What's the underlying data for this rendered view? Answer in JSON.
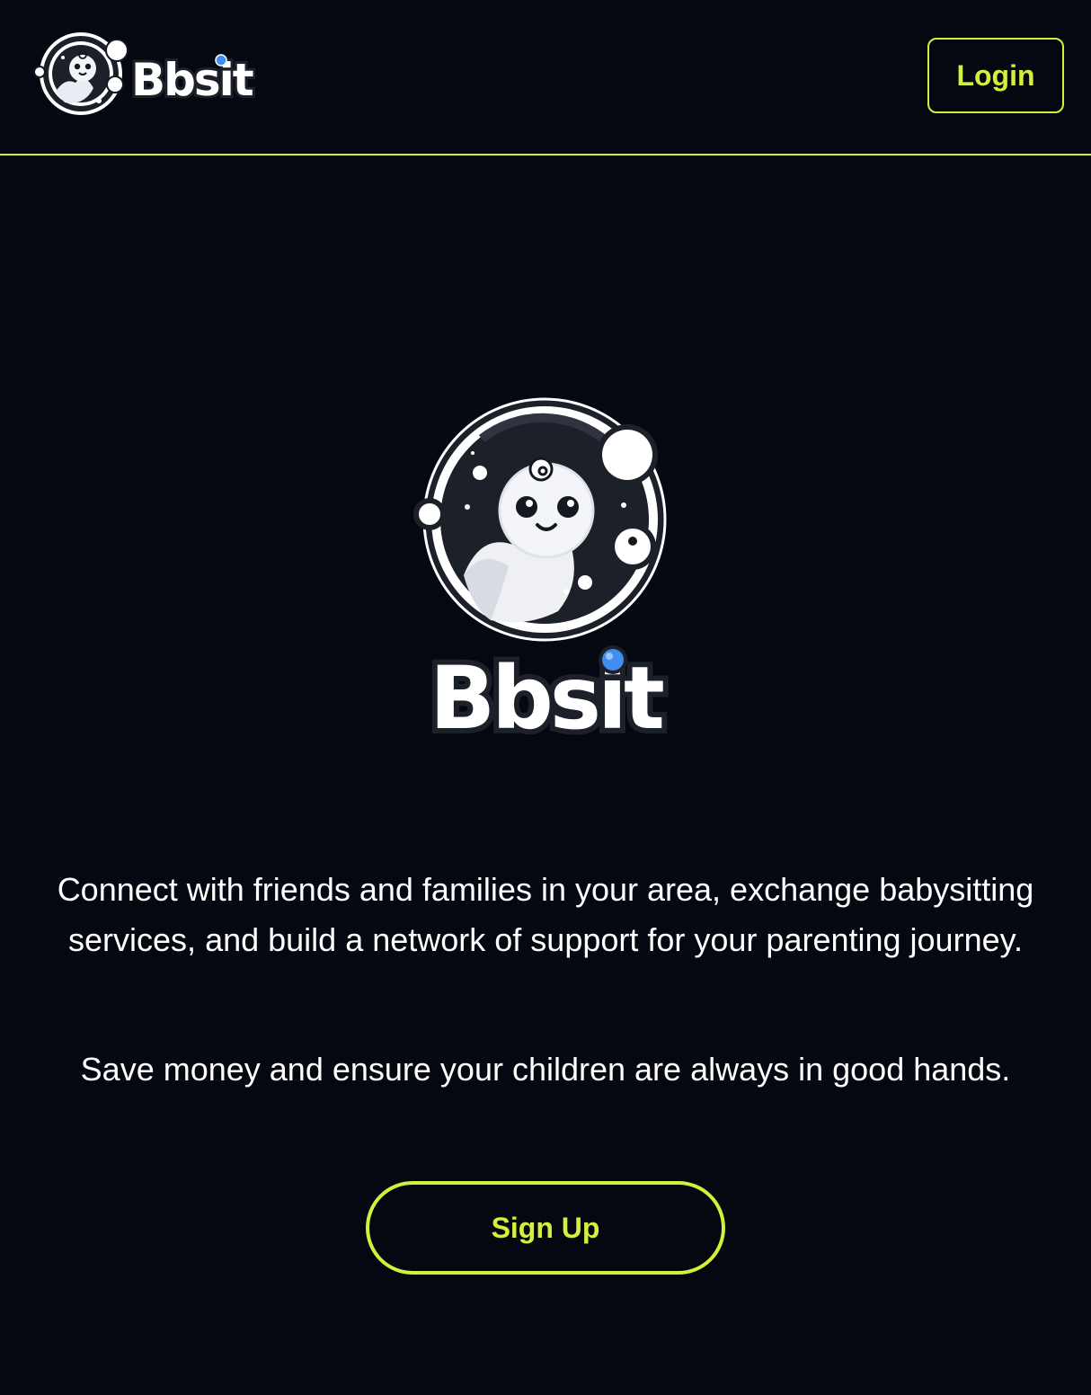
{
  "header": {
    "brand_name": "Bbsit",
    "login_label": "Login"
  },
  "hero": {
    "brand_name": "Bbsit",
    "tagline": "Connect with friends and families in your area, exchange babysitting services, and build a network of support for your parenting journey.",
    "subtagline": "Save money and ensure your children are always in good hands.",
    "signup_label": "Sign Up"
  },
  "colors": {
    "background": "#050811",
    "accent": "#d4f03c",
    "text": "#ffffff",
    "logo_dot": "#3f8ef0"
  }
}
